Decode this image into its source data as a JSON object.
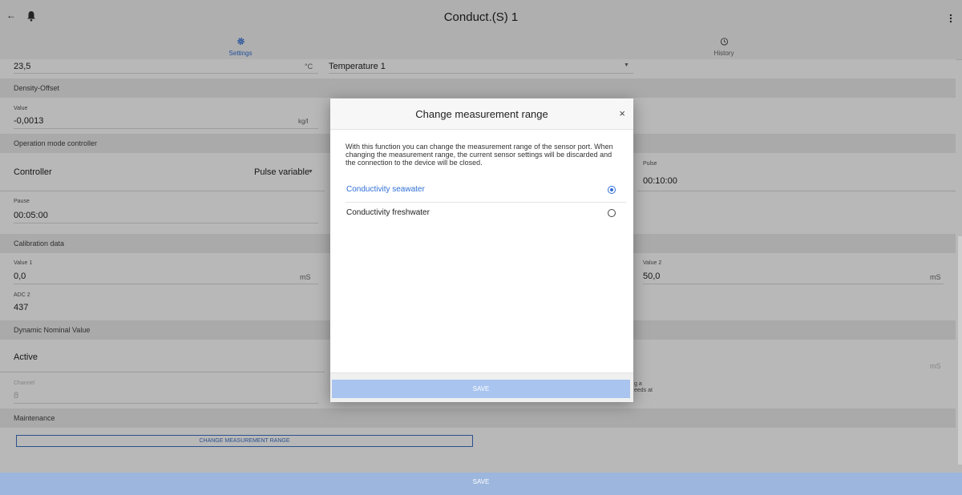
{
  "app": {
    "title": "Conduct.(S) 1"
  },
  "tabs": [
    {
      "label": "Settings",
      "icon": "gear-icon"
    },
    {
      "label": "History",
      "icon": "timer-icon"
    }
  ],
  "temperature": {
    "value": "23,5",
    "unit": "°C",
    "select": "Temperature 1"
  },
  "density_offset": {
    "section": "Density-Offset",
    "label": "Value",
    "value": "-0,0013",
    "unit": "kg/l"
  },
  "operation": {
    "section": "Operation mode controller",
    "controller_label": "Controller",
    "controller_value": "Pulse variable",
    "pulse_label": "Pulse",
    "pulse_value": "00:10:00",
    "pause_label": "Pause",
    "pause_value": "00:05:00"
  },
  "calibration": {
    "section": "Calibration data",
    "value1_label": "Value 1",
    "value1": "0,0",
    "value1_unit": "mS",
    "value2_label": "Value 2",
    "value2": "50,0",
    "value2_unit": "mS",
    "adc2_label": "ADC 2",
    "adc2": "437"
  },
  "dynamic": {
    "section": "Dynamic Nominal Value",
    "active_label": "Active",
    "right_unit": "mS",
    "channel_label": "Channel",
    "channel_value": "8",
    "partial1": "g a",
    "partial2": "eeds at"
  },
  "maintenance": {
    "section": "Maintenance",
    "button": "CHANGE MEASUREMENT RANGE"
  },
  "footer": {
    "save": "SAVE"
  },
  "modal": {
    "title": "Change measurement range",
    "close": "×",
    "description": "With this function you can change the measurement range of the sensor port. When changing the measurement range, the current sensor settings will be discarded and the connection to the device will be closed.",
    "options": [
      {
        "label": "Conductivity seawater",
        "selected": true
      },
      {
        "label": "Conductivity freshwater",
        "selected": false
      }
    ],
    "save": "SAVE"
  },
  "colors": {
    "accent": "#2f6fd6",
    "save_disabled": "#a9c4ee",
    "footer_bar": "#9cb6dd"
  }
}
